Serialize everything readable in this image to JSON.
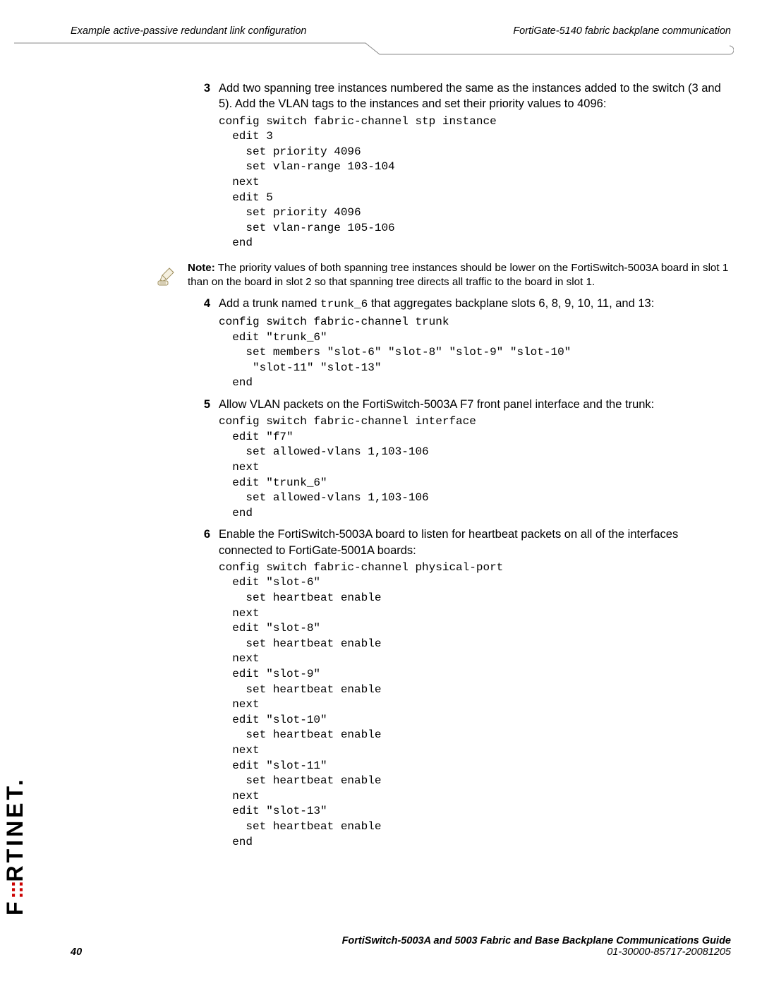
{
  "header": {
    "left": "Example active-passive redundant link configuration",
    "right": "FortiGate-5140 fabric backplane communication"
  },
  "steps": {
    "s3": {
      "num": "3",
      "text": "Add two spanning tree instances numbered the same as the instances added to the switch (3 and 5). Add the VLAN tags to the instances and set their priority values to 4096:",
      "code": "config switch fabric-channel stp instance\n  edit 3\n    set priority 4096\n    set vlan-range 103-104\n  next\n  edit 5\n    set priority 4096\n    set vlan-range 105-106\n  end"
    },
    "note": {
      "label": "Note:",
      "text": " The priority values of both spanning tree instances should be lower on the FortiSwitch-5003A board in slot 1 than on the board in slot 2 so that spanning tree directs all traffic to the board in slot 1."
    },
    "s4": {
      "num": "4",
      "text_pre": "Add a trunk named ",
      "text_code": "trunk_6",
      "text_post": " that aggregates backplane slots 6, 8, 9, 10, 11, and 13:",
      "code": "config switch fabric-channel trunk\n  edit \"trunk_6\"\n    set members \"slot-6\" \"slot-8\" \"slot-9\" \"slot-10\" \n     \"slot-11\" \"slot-13\"\n  end"
    },
    "s5": {
      "num": "5",
      "text": "Allow VLAN packets on the FortiSwitch-5003A F7 front panel interface and the trunk:",
      "code": "config switch fabric-channel interface\n  edit \"f7\"\n    set allowed-vlans 1,103-106\n  next\n  edit \"trunk_6\"\n    set allowed-vlans 1,103-106\n  end"
    },
    "s6": {
      "num": "6",
      "text": "Enable the FortiSwitch-5003A board to listen for heartbeat packets on all of the interfaces connected to FortiGate-5001A boards:",
      "code": "config switch fabric-channel physical-port\n  edit \"slot-6\"\n    set heartbeat enable\n  next\n  edit \"slot-8\"\n    set heartbeat enable\n  next\n  edit \"slot-9\"\n    set heartbeat enable\n  next\n  edit \"slot-10\"\n    set heartbeat enable\n  next\n  edit \"slot-11\"\n    set heartbeat enable\n  next\n  edit \"slot-13\"\n    set heartbeat enable\n  end"
    }
  },
  "footer": {
    "line1": "FortiSwitch-5003A and 5003   Fabric and Base Backplane Communications Guide",
    "page": "40",
    "docid": "01-30000-85717-20081205"
  },
  "brand": {
    "part1": "F",
    "dots": ":::",
    "part2": "RTINET",
    "dot": "."
  }
}
